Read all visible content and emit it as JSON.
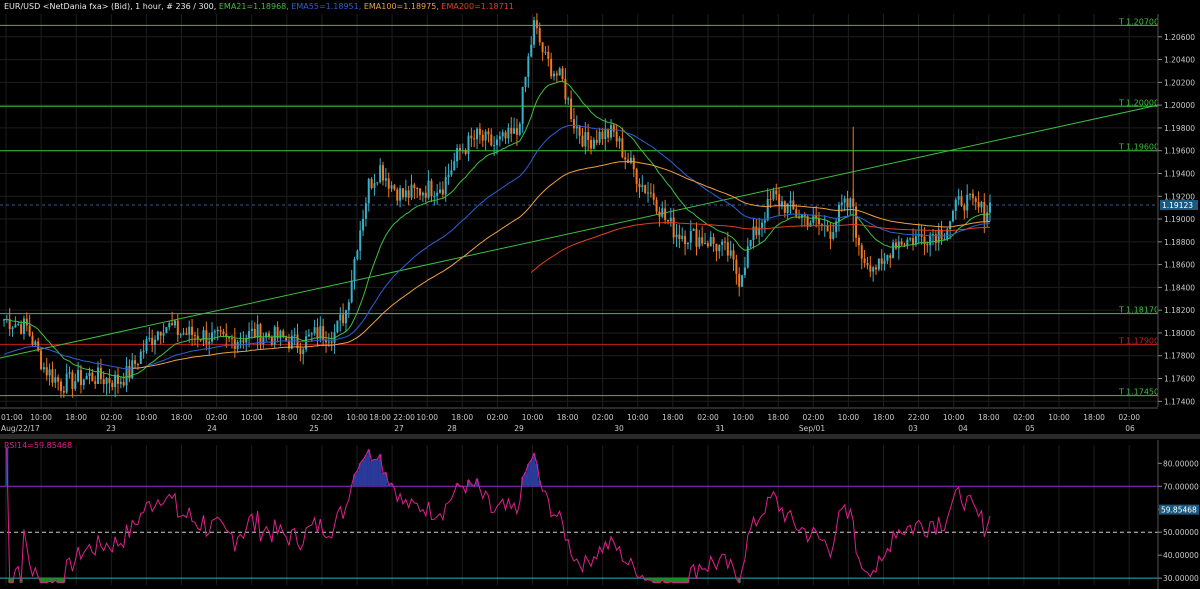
{
  "header": {
    "parts": [
      {
        "text": "EUR/USD <NetDania fxa> (Bid), 1 hour, # 236 / 300, ",
        "color": "#e8e8e8"
      },
      {
        "text": "EMA21=1.18968, ",
        "color": "#3fbf3f"
      },
      {
        "text": "EMA55=1.18951, ",
        "color": "#2f5fd8"
      },
      {
        "text": "EMA100=1.18975, ",
        "color": "#f0a040"
      },
      {
        "text": "EMA200=1.18711",
        "color": "#e04020"
      }
    ]
  },
  "colors": {
    "bull": "#3ab0c8",
    "bear": "#f07820",
    "ema21": "#3fbf3f",
    "ema55": "#2f5fd8",
    "ema100": "#f0a040",
    "ema200": "#e04020",
    "hline_green": "#3fbf3f",
    "hline_red": "#c02020",
    "rsi_line": "#e0208c",
    "rsi_upper": "#9a2ad0",
    "rsi_lower": "#2ab0c8",
    "rsi_fill_over": "#2a3a9a",
    "rsi_fill_under": "#1e8a1e",
    "grid": "#1e1e1e"
  },
  "chart_data": [
    {
      "type": "candlestick",
      "title": "EUR/USD <NetDania fxa> (Bid), 1 hour",
      "ylim": [
        1.1735,
        1.208
      ],
      "y_ticks": [
        1.174,
        1.176,
        1.178,
        1.18,
        1.182,
        1.184,
        1.186,
        1.188,
        1.19,
        1.192,
        1.194,
        1.196,
        1.198,
        1.2,
        1.202,
        1.204,
        1.206
      ],
      "y_tick_labels": [
        "1.17400",
        "1.17600",
        "1.17800",
        "1.18000",
        "1.18200",
        "1.18400",
        "1.18600",
        "1.18800",
        "1.19000",
        "1.19200",
        "1.19400",
        "1.19600",
        "1.19800",
        "1.20000",
        "1.20200",
        "1.20400",
        "1.20600"
      ],
      "x_time_labels": [
        "01:00",
        "10:00",
        "18:00",
        "02:00",
        "10:00",
        "18:00",
        "02:00",
        "10:00",
        "18:00",
        "02:00",
        "10:00",
        "18:00 22:00",
        "10:00",
        "18:00",
        "02:00",
        "10:00",
        "18:00",
        "02:00",
        "10:00",
        "18:00",
        "02:00",
        "10:00",
        "18:00",
        "02:00",
        "10:00",
        "18:00",
        "22:00",
        "10:00",
        "18:00",
        "02:00",
        "10:00",
        "18:00",
        "02:00"
      ],
      "x_date_labels": [
        "Aug/22/17",
        "23",
        "24",
        "25",
        "27",
        "28",
        "29",
        "30",
        "31",
        "Sep/01",
        "03",
        "04",
        "05",
        "06"
      ],
      "current_price": "1.19123",
      "horizontal_levels": [
        {
          "value": 1.207,
          "label": "1.20700",
          "color": "#3fbf3f"
        },
        {
          "value": 1.1999,
          "label": "1.20000",
          "color": "#3fbf3f"
        },
        {
          "value": 1.196,
          "label": "1.19600",
          "color": "#3fbf3f"
        },
        {
          "value": 1.1817,
          "label": "1.18170",
          "color": "#3fbf3f"
        },
        {
          "value": 1.179,
          "label": "1.17900",
          "color": "#c02020"
        },
        {
          "value": 1.1745,
          "label": "1.17450",
          "color": "#3fbf3f"
        }
      ],
      "trendline": {
        "from": [
          0,
          1.1778
        ],
        "to": [
          1,
          1.2
        ]
      },
      "series": [
        {
          "name": "EMA21",
          "value": "1.18968"
        },
        {
          "name": "EMA55",
          "value": "1.18951"
        },
        {
          "name": "EMA100",
          "value": "1.18975"
        },
        {
          "name": "EMA200",
          "value": "1.18711"
        }
      ]
    },
    {
      "type": "line",
      "title": "RSI14=59.85468",
      "ylim": [
        27,
        88
      ],
      "y_ticks": [
        30,
        40,
        50,
        60,
        70,
        80
      ],
      "y_tick_labels": [
        "30.00000",
        "40.00000",
        "50.00000",
        "60.00000",
        "70.00000",
        "80.00000"
      ],
      "levels": [
        70,
        50,
        30
      ],
      "current_value": "59.85468"
    }
  ],
  "rsi_label": "RSI14=59.85468"
}
